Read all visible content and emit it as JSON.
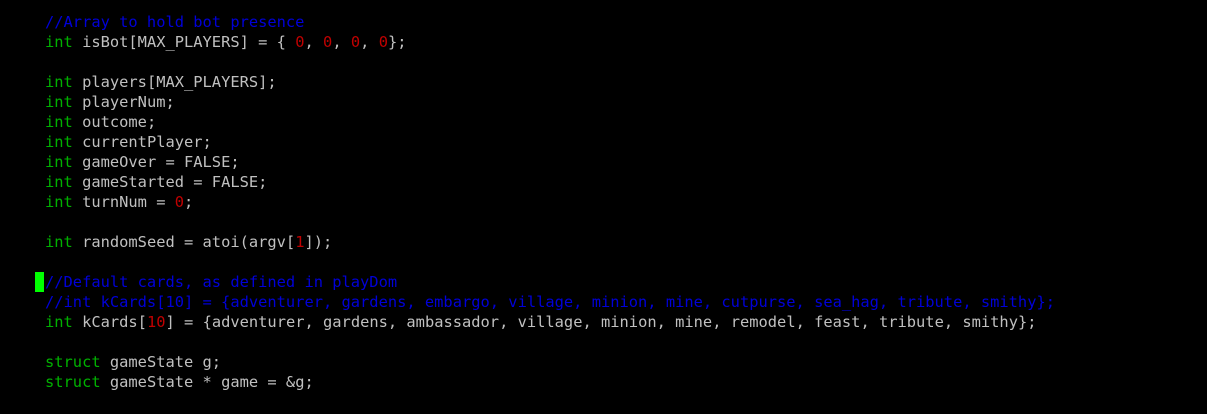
{
  "colors": {
    "background": "#000000",
    "text": "#c0c0c0",
    "keyword": "#00b000",
    "number": "#c00000",
    "comment": "#0000d8",
    "cursor": "#00ff00"
  },
  "lines": [
    {
      "tokens": [
        {
          "t": "cmt",
          "v": "//Array to hold bot presence"
        }
      ]
    },
    {
      "tokens": [
        {
          "t": "kw",
          "v": "int"
        },
        {
          "t": "txt",
          "v": " isBot[MAX_PLAYERS] = { "
        },
        {
          "t": "num",
          "v": "0"
        },
        {
          "t": "txt",
          "v": ", "
        },
        {
          "t": "num",
          "v": "0"
        },
        {
          "t": "txt",
          "v": ", "
        },
        {
          "t": "num",
          "v": "0"
        },
        {
          "t": "txt",
          "v": ", "
        },
        {
          "t": "num",
          "v": "0"
        },
        {
          "t": "txt",
          "v": "};"
        }
      ]
    },
    {
      "tokens": []
    },
    {
      "tokens": [
        {
          "t": "kw",
          "v": "int"
        },
        {
          "t": "txt",
          "v": " players[MAX_PLAYERS];"
        }
      ]
    },
    {
      "tokens": [
        {
          "t": "kw",
          "v": "int"
        },
        {
          "t": "txt",
          "v": " playerNum;"
        }
      ]
    },
    {
      "tokens": [
        {
          "t": "kw",
          "v": "int"
        },
        {
          "t": "txt",
          "v": " outcome;"
        }
      ]
    },
    {
      "tokens": [
        {
          "t": "kw",
          "v": "int"
        },
        {
          "t": "txt",
          "v": " currentPlayer;"
        }
      ]
    },
    {
      "tokens": [
        {
          "t": "kw",
          "v": "int"
        },
        {
          "t": "txt",
          "v": " gameOver = FALSE;"
        }
      ]
    },
    {
      "tokens": [
        {
          "t": "kw",
          "v": "int"
        },
        {
          "t": "txt",
          "v": " gameStarted = FALSE;"
        }
      ]
    },
    {
      "tokens": [
        {
          "t": "kw",
          "v": "int"
        },
        {
          "t": "txt",
          "v": " turnNum = "
        },
        {
          "t": "num",
          "v": "0"
        },
        {
          "t": "txt",
          "v": ";"
        }
      ]
    },
    {
      "tokens": []
    },
    {
      "tokens": [
        {
          "t": "kw",
          "v": "int"
        },
        {
          "t": "txt",
          "v": " randomSeed = atoi(argv["
        },
        {
          "t": "num",
          "v": "1"
        },
        {
          "t": "txt",
          "v": "]);"
        }
      ]
    },
    {
      "tokens": []
    },
    {
      "cursor": true,
      "tokens": [
        {
          "t": "cmt",
          "v": "//Default cards, as defined in playDom"
        }
      ]
    },
    {
      "tokens": [
        {
          "t": "cmt",
          "v": "//int kCards[10] = {adventurer, gardens, embargo, village, minion, mine, cutpurse, sea_hag, tribute, smithy};"
        }
      ]
    },
    {
      "tokens": [
        {
          "t": "kw",
          "v": "int"
        },
        {
          "t": "txt",
          "v": " kCards["
        },
        {
          "t": "num",
          "v": "10"
        },
        {
          "t": "txt",
          "v": "] = {adventurer, gardens, ambassador, village, minion, mine, remodel, feast, tribute, smithy};"
        }
      ]
    },
    {
      "tokens": []
    },
    {
      "tokens": [
        {
          "t": "kw",
          "v": "struct"
        },
        {
          "t": "txt",
          "v": " gameState g;"
        }
      ]
    },
    {
      "tokens": [
        {
          "t": "kw",
          "v": "struct"
        },
        {
          "t": "txt",
          "v": " gameState * game = &g;"
        }
      ]
    }
  ]
}
